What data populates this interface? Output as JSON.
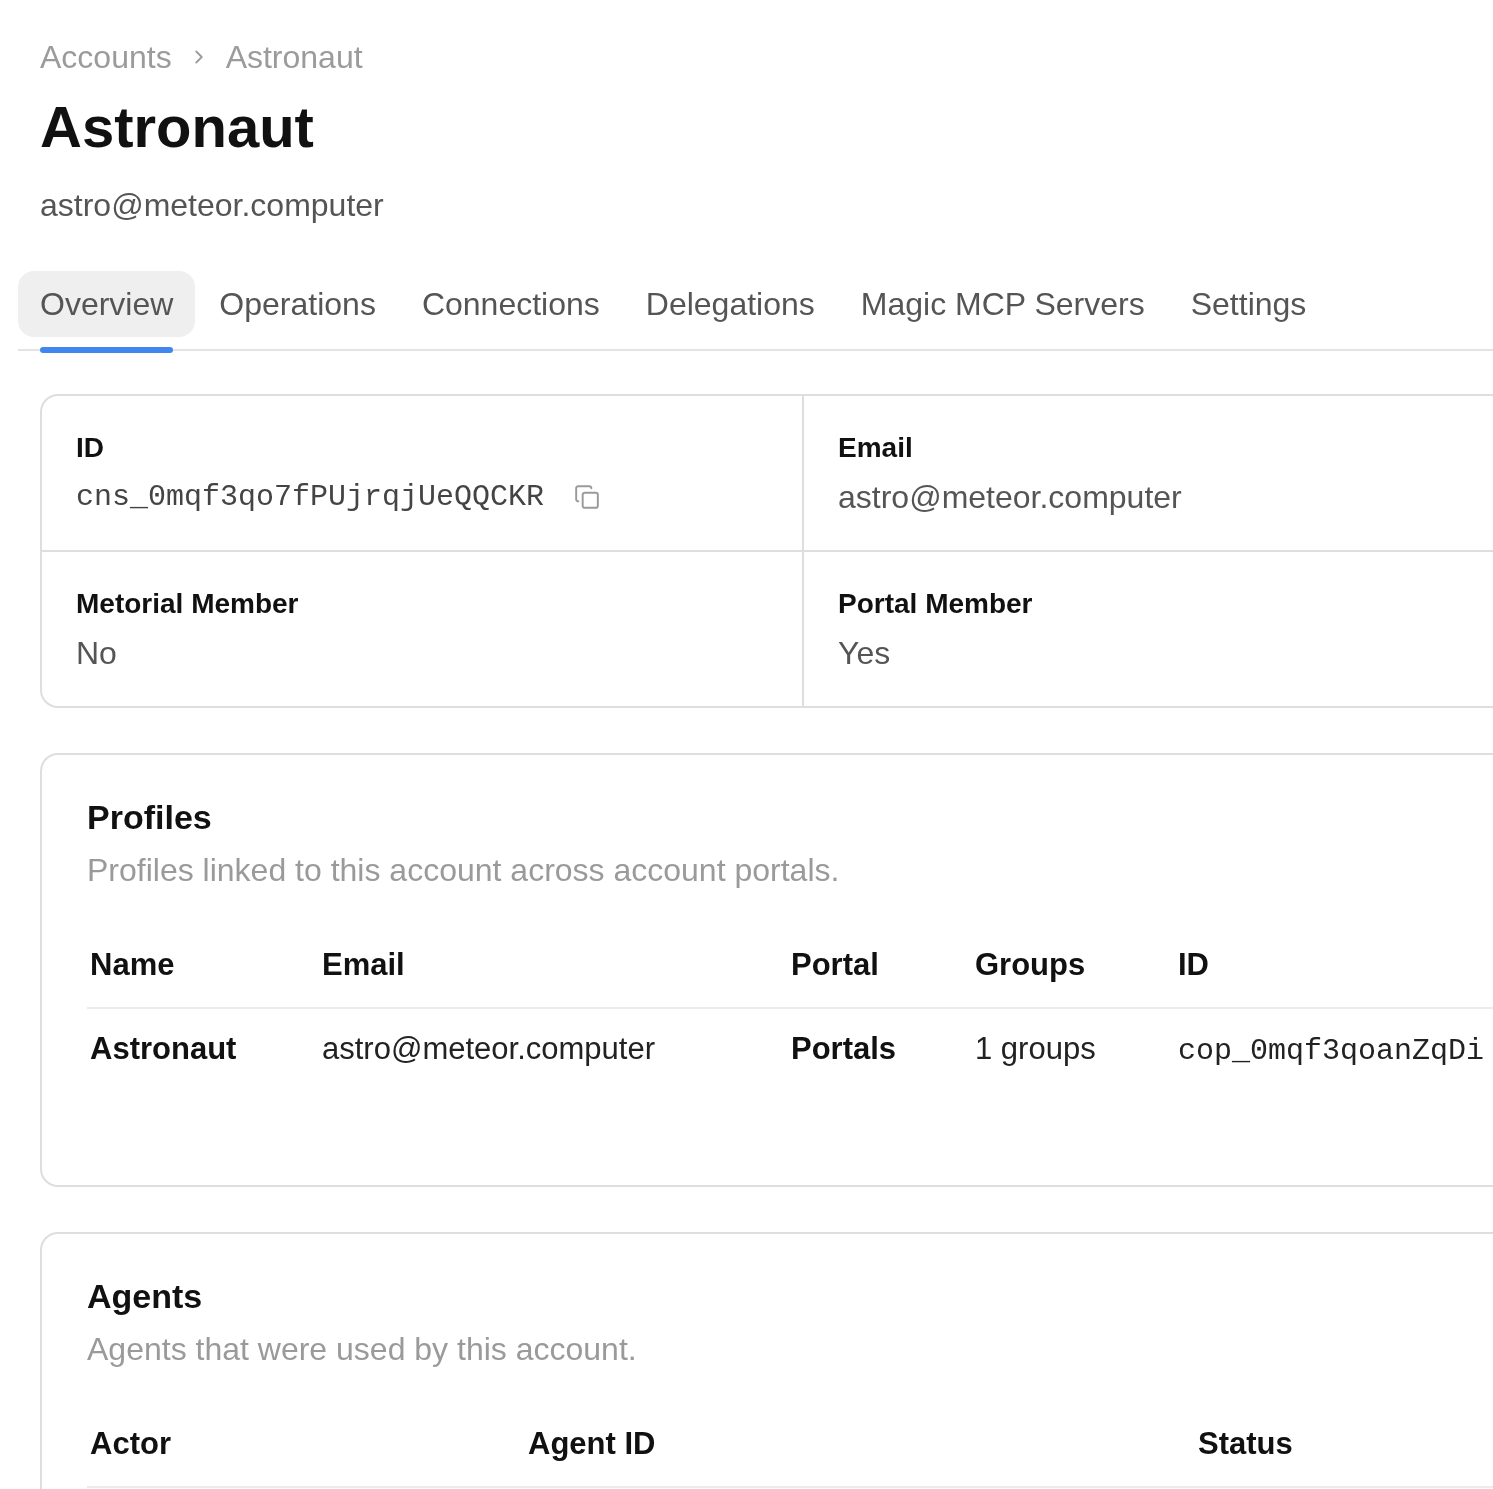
{
  "breadcrumb": [
    {
      "label": "Accounts"
    },
    {
      "label": "Astronaut"
    }
  ],
  "page": {
    "title": "Astronaut",
    "subtitle": "astro@meteor.computer"
  },
  "tabs": [
    {
      "label": "Overview",
      "selected": true
    },
    {
      "label": "Operations",
      "selected": false
    },
    {
      "label": "Connections",
      "selected": false
    },
    {
      "label": "Delegations",
      "selected": false
    },
    {
      "label": "Magic MCP Servers",
      "selected": false
    },
    {
      "label": "Settings",
      "selected": false
    }
  ],
  "details": [
    {
      "label": "ID",
      "value": "cns_0mqf3qo7fPUjrqjUeQQCKR",
      "kind": "code"
    },
    {
      "label": "Email",
      "value": "astro@meteor.computer",
      "kind": "text"
    },
    {
      "label": "Metorial Member",
      "value": "No",
      "kind": "text"
    },
    {
      "label": "Portal Member",
      "value": "Yes",
      "kind": "text"
    }
  ],
  "profiles": {
    "title": "Profiles",
    "description": "Profiles linked to this account across account portals.",
    "columns": [
      "Name",
      "Email",
      "Portal",
      "Groups",
      "ID"
    ],
    "rows": [
      [
        {
          "text": "Astronaut",
          "kind": "strong"
        },
        {
          "text": "astro@meteor.computer",
          "kind": "text"
        },
        {
          "text": "Portals",
          "kind": "strong"
        },
        {
          "text": "1 groups",
          "kind": "text"
        },
        {
          "text": "cop_0mqf3qoanZqDi",
          "kind": "code"
        }
      ]
    ]
  },
  "agents": {
    "title": "Agents",
    "description": "Agents that were used by this account.",
    "columns": [
      "Actor",
      "Agent ID",
      "Status"
    ]
  }
}
